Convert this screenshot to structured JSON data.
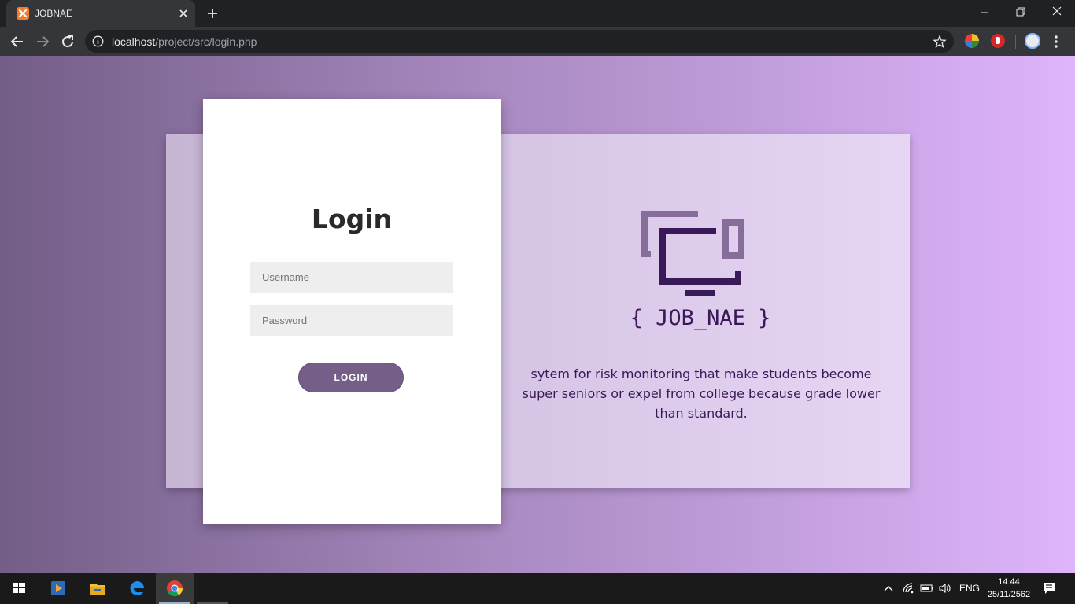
{
  "browser": {
    "tab_title": "JOBNAE",
    "url_host": "localhost",
    "url_path": "/project/src/login.php"
  },
  "page": {
    "login_title": "Login",
    "username_placeholder": "Username",
    "password_placeholder": "Password",
    "login_button": "LOGIN",
    "brand_name": "{ JOB_NAE }",
    "brand_description": "sytem for risk monitoring that make students become super seniors or expel from college because grade lower than standard."
  },
  "taskbar": {
    "language": "ENG",
    "time": "14:44",
    "date": "25/11/2562"
  },
  "colors": {
    "brand_dark": "#3a1958",
    "button": "#755f88",
    "gradient_start": "#735e87",
    "gradient_end": "#deb4fb"
  },
  "icons": {
    "tab": "xampp-icon",
    "logo": "monitor-logo-icon",
    "taskbar": [
      "windows-start-icon",
      "media-player-icon",
      "file-explorer-icon",
      "edge-icon",
      "chrome-icon"
    ]
  }
}
